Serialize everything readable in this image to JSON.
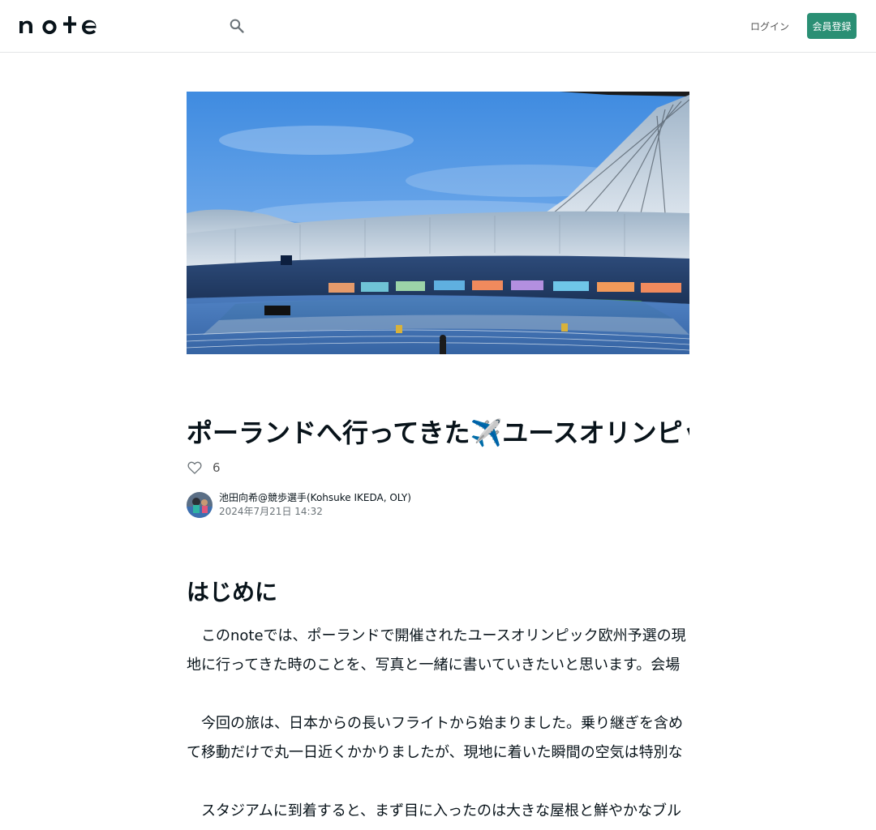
{
  "header": {
    "logo_text": "note",
    "login_label": "ログイン",
    "signup_label": "会員登録"
  },
  "icons": {
    "search": "search-icon",
    "like": "heart-icon"
  },
  "colors": {
    "brand_green": "#2a8f74",
    "text": "#08131a",
    "muted": "#6b7378"
  },
  "article": {
    "hero_alt": "競技場のスタンドと陸上トラック",
    "title": "ポーランドへ行ってきた✈️ユースオリンピック予選",
    "likes": "6",
    "author_name": "池田向希@競歩選手(Kohsuke IKEDA, OLY)",
    "date": "2024年7月21日 14:32",
    "section_heading": "はじめに",
    "paragraphs": [
      "　このnoteでは、ポーランドで開催されたユースオリンピック欧州予選の現地に行ってきた時のことを、写真と一緒に書いていきたいと思います。会場の雰囲気や選手の様子などをお伝えできればと思います。",
      "　今回の旅は、日本からの長いフライトから始まりました。乗り継ぎを含めて移動だけで丸一日近くかかりましたが、現地に着いた瞬間の空気は特別なものでした。",
      "　スタジアムに到着すると、まず目に入ったのは大きな屋根と鮮やかなブルーのトラックでした。スタンドには各国の応援団が集まっていて、大会の熱気が伝わってきました。"
    ]
  }
}
